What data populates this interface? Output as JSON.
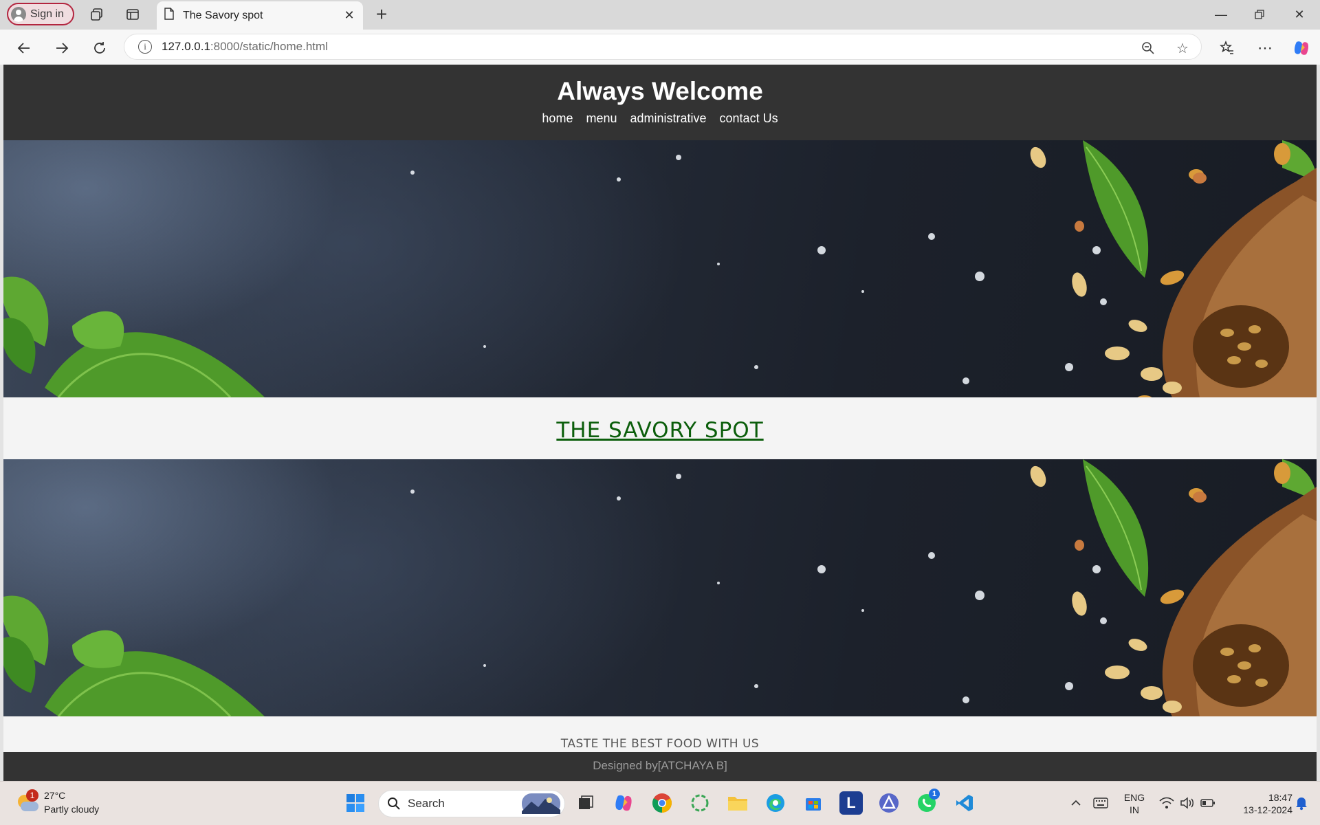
{
  "browser": {
    "signin_label": "Sign in",
    "tab_title": "The Savory spot",
    "url_host": "127.0.0.1",
    "url_path": ":8000/static/home.html"
  },
  "page": {
    "title": "Always Welcome",
    "nav": [
      {
        "label": "home"
      },
      {
        "label": "menu"
      },
      {
        "label": "administrative"
      },
      {
        "label": "contact Us"
      }
    ],
    "brand": "THE SAVORY SPOT",
    "tagline": "TASTE THE BEST FOOD WITH US",
    "footer": "Designed by[ATCHAYA B]"
  },
  "taskbar": {
    "weather_temp": "27°C",
    "weather_desc": "Partly cloudy",
    "weather_badge": "1",
    "search_label": "Search",
    "whatsapp_badge": "1",
    "lang_top": "ENG",
    "lang_bottom": "IN",
    "time": "18:47",
    "date": "13-12-2024"
  },
  "colors": {
    "header_bg": "#333333",
    "brand_green": "#0b5e0b",
    "signin_border": "#b3253f"
  }
}
